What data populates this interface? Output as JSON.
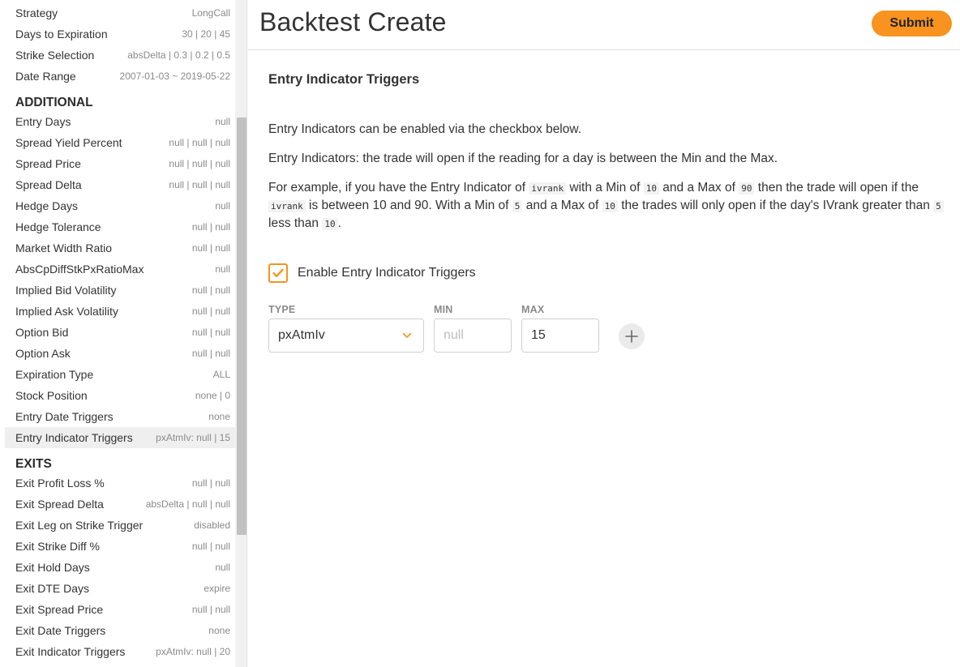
{
  "header": {
    "title": "Backtest Create",
    "submit_label": "Submit"
  },
  "sidebar": {
    "top_items": [
      {
        "label": "Strategy",
        "value": "LongCall"
      },
      {
        "label": "Days to Expiration",
        "value": "30 | 20 | 45"
      },
      {
        "label": "Strike Selection",
        "value": "absDelta | 0.3 | 0.2 | 0.5"
      },
      {
        "label": "Date Range",
        "value": "2007-01-03 ~ 2019-05-22"
      }
    ],
    "additional_title": "ADDITIONAL",
    "additional_items": [
      {
        "label": "Entry Days",
        "value": "null"
      },
      {
        "label": "Spread Yield Percent",
        "value": "null | null | null"
      },
      {
        "label": "Spread Price",
        "value": "null | null | null"
      },
      {
        "label": "Spread Delta",
        "value": "null | null | null"
      },
      {
        "label": "Hedge Days",
        "value": "null"
      },
      {
        "label": "Hedge Tolerance",
        "value": "null | null"
      },
      {
        "label": "Market Width Ratio",
        "value": "null | null"
      },
      {
        "label": "AbsCpDiffStkPxRatioMax",
        "value": "null"
      },
      {
        "label": "Implied Bid Volatility",
        "value": "null | null"
      },
      {
        "label": "Implied Ask Volatility",
        "value": "null | null"
      },
      {
        "label": "Option Bid",
        "value": "null | null"
      },
      {
        "label": "Option Ask",
        "value": "null | null"
      },
      {
        "label": "Expiration Type",
        "value": "ALL"
      },
      {
        "label": "Stock Position",
        "value": "none | 0"
      },
      {
        "label": "Entry Date Triggers",
        "value": "none"
      },
      {
        "label": "Entry Indicator Triggers",
        "value": "pxAtmIv: null | 15",
        "active": true
      }
    ],
    "exits_title": "EXITS",
    "exits_items": [
      {
        "label": "Exit Profit Loss %",
        "value": "null | null"
      },
      {
        "label": "Exit Spread Delta",
        "value": "absDelta | null | null"
      },
      {
        "label": "Exit Leg on Strike Trigger",
        "value": "disabled"
      },
      {
        "label": "Exit Strike Diff %",
        "value": "null | null"
      },
      {
        "label": "Exit Hold Days",
        "value": "null"
      },
      {
        "label": "Exit DTE Days",
        "value": "expire"
      },
      {
        "label": "Exit Spread Price",
        "value": "null | null"
      },
      {
        "label": "Exit Date Triggers",
        "value": "none"
      },
      {
        "label": "Exit Indicator Triggers",
        "value": "pxAtmIv: null | 20"
      }
    ]
  },
  "main": {
    "section_title": "Entry Indicator Triggers",
    "para1": "Entry Indicators can be enabled via the checkbox below.",
    "para2": "Entry Indicators: the trade will open if the reading for a day is between the Min and the Max.",
    "para3": {
      "t1": "For example, if you have the Entry Indicator of ",
      "c1": "ivrank",
      "t2": " with a Min of ",
      "c2": "10",
      "t3": " and a Max of ",
      "c3": "90",
      "t4": " then the trade will open if the ",
      "c4": "ivrank",
      "t5": " is between 10 and 90. With a Min of ",
      "c5": "5",
      "t6": " and a Max of ",
      "c6": "10",
      "t7": " the trades will only open if the day's IVrank greater than ",
      "c7": "5",
      "t8": " less than ",
      "c8": "10",
      "t9": "."
    },
    "enable_label": "Enable Entry Indicator Triggers",
    "enable_checked": true,
    "fields": {
      "type_label": "TYPE",
      "type_value": "pxAtmIv",
      "min_label": "MIN",
      "min_placeholder": "null",
      "max_label": "MAX",
      "max_value": "15"
    }
  },
  "colors": {
    "accent": "#f7931e",
    "active_row": "#efefef",
    "muted": "#8a8a8a"
  },
  "icons": {
    "checkbox": "check-icon",
    "select": "chevron-down-icon",
    "add": "plus-icon"
  }
}
